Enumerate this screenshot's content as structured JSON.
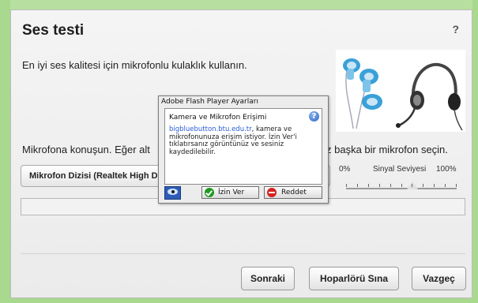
{
  "dialog": {
    "title": "Ses testi",
    "help": "?",
    "intro": "En iyi ses kalitesi için mikrofonlu kulaklık kullanın.",
    "speak_left": "Mikrofona konuşun. Eğer alt",
    "speak_right": "iniz başka bir mikrofon seçin.",
    "mic_value": "Mikrofon Dizisi (Realtek High Definition Audio)",
    "signal": {
      "min": "0%",
      "label": "Sinyal Seviyesi",
      "max": "100%",
      "level": 0.6
    },
    "buttons": {
      "next": "Sonraki",
      "test_speaker": "Hoparlörü Sına",
      "cancel": "Vazgeç"
    }
  },
  "flash": {
    "title": "Adobe Flash Player Ayarları",
    "heading": "Kamera ve Mikrofon Erişimi",
    "help": "?",
    "domain": "bigbluebutton.btu.edu.tr",
    "message": ", kamera ve mikrofonunuza erişim istiyor. İzin Ver'i tıklatırsanız görüntünüz ve sesiniz kaydedilebilir.",
    "allow": "İzin Ver",
    "deny": "Reddet"
  },
  "icons": {
    "help": "question-icon",
    "headsets": "headsets-image",
    "flash_settings": "webcam-monitor-icon",
    "allow": "check-icon",
    "deny": "deny-icon"
  },
  "colors": {
    "accent_green": "#a9d98f",
    "link_blue": "#2a5bd8",
    "allow_green": "#1e9a22",
    "deny_red": "#d42222"
  }
}
